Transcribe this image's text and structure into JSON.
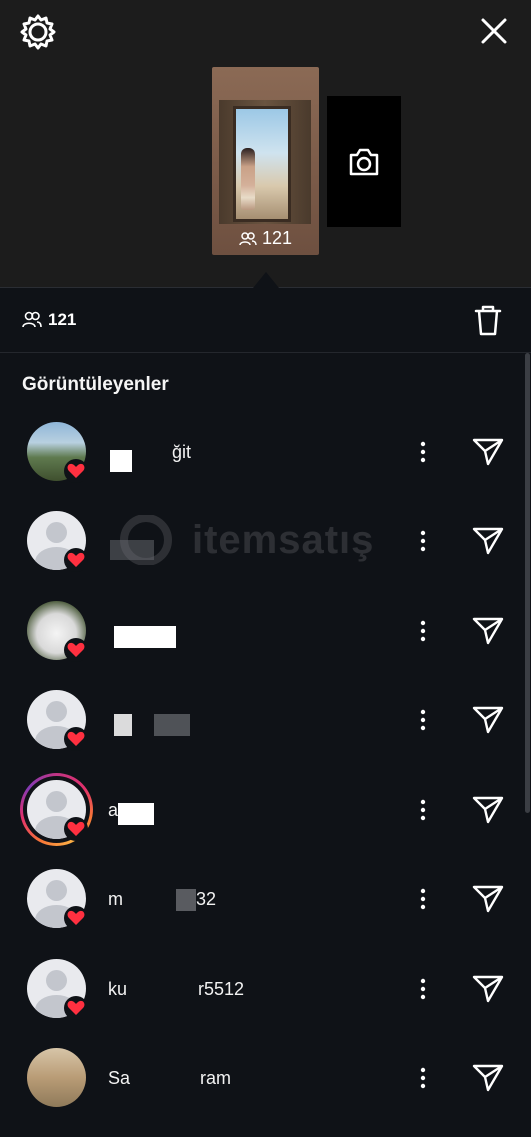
{
  "header": {
    "settings_icon": "gear-icon",
    "close_icon": "close-icon"
  },
  "story": {
    "view_count": "121",
    "camera_icon": "camera-icon"
  },
  "stats": {
    "viewer_count": "121",
    "delete_icon": "trash-icon"
  },
  "viewers": {
    "title": "Görüntüleyenler",
    "items": [
      {
        "username": "ğit",
        "avatar": "photo",
        "liked": true
      },
      {
        "username": "",
        "avatar": "default",
        "liked": true
      },
      {
        "username": "",
        "avatar": "photo",
        "liked": true
      },
      {
        "username": "",
        "avatar": "default",
        "liked": true
      },
      {
        "username": "a",
        "avatar": "default",
        "liked": true,
        "has_story_ring": true
      },
      {
        "username": "m",
        "username_suffix": "32",
        "avatar": "default",
        "liked": true
      },
      {
        "username": "ku",
        "username_suffix": "r5512",
        "avatar": "default",
        "liked": true
      },
      {
        "username": "Sa",
        "username_suffix": "ram",
        "avatar": "photo",
        "liked": true
      }
    ]
  },
  "watermark": {
    "text": "itemsatış"
  },
  "colors": {
    "background": "#0f1217",
    "top_background": "#1c1c1c",
    "heart": "#ff3040",
    "text": "#ffffff"
  }
}
